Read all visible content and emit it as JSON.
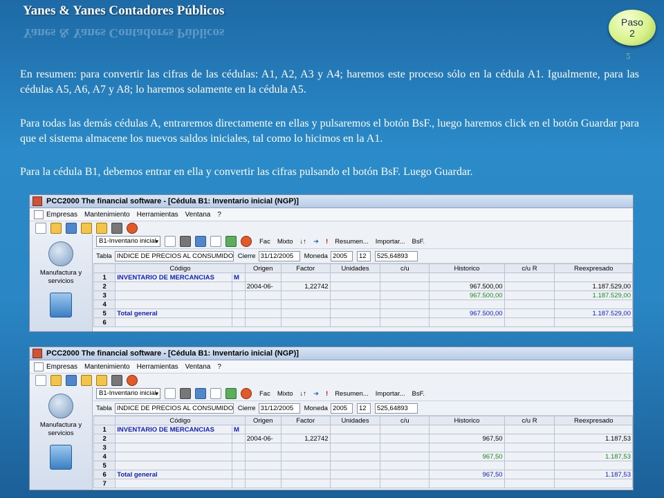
{
  "slide": {
    "title": "Yanes & Yanes Contadores Públicos",
    "step_line1": "Paso",
    "step_line2": "2",
    "step_reflect": "2",
    "para1": "En resumen: para convertir las cifras de las cédulas: A1, A2, A3 y A4; haremos este proceso sólo en la cédula A1. Igualmente, para las cédulas A5, A6, A7 y A8; lo haremos solamente en la cédula A5.",
    "para2": "Para todas las demás cédulas A, entraremos directamente en ellas y pulsaremos el botón BsF., luego haremos click en el botón Guardar para que el sistema almacene los nuevos saldos iniciales, tal como lo hicimos en la A1.",
    "para3": "Para la cédula B1, debemos entrar en ella y convertir las cifras pulsando el botón BsF. Luego Guardar."
  },
  "app": {
    "window_title": "PCC2000 The financial software - [Cédula B1: Inventario inicial (NGP)]",
    "menu": [
      "Empresas",
      "Mantenimiento",
      "Herramientas",
      "Ventana",
      "?"
    ],
    "sidebar_label": "Manufactura y servicios",
    "sheet_combo": "B1-Inventario inicial",
    "buttons": {
      "fac": "Fac",
      "mixto": "Mixto",
      "resumen": "Resumen...",
      "importar": "Importar...",
      "bsf": "BsF."
    },
    "labels": {
      "tabla": "Tabla",
      "cierre": "Cierre",
      "moneda": "Moneda"
    },
    "fields": {
      "tabla": "INDICE DE PRECIOS AL CONSUMIDOR",
      "cierre": "31/12/2005",
      "year": "2005",
      "month": "12",
      "factor_val": "525,64893"
    },
    "columns": [
      "Código",
      "Origen",
      "Factor",
      "Unidades",
      "c/u",
      "Historico",
      "c/u R",
      "Reexpresado"
    ]
  },
  "grid1": {
    "rows": [
      {
        "n": "1",
        "codigo": "INVENTARIO DE MERCANCIAS",
        "m": "M",
        "origen": "",
        "factor": "",
        "historico": "",
        "reexp": ""
      },
      {
        "n": "2",
        "codigo": "",
        "m": "",
        "origen": "2004-06-",
        "factor": "1,22742",
        "historico": "967.500,00",
        "reexp": "1.187.529,00"
      },
      {
        "n": "3",
        "codigo": "",
        "m": "",
        "origen": "",
        "factor": "",
        "historico": "967.500,00",
        "reexp": "1.187.529,00"
      },
      {
        "n": "4",
        "codigo": "",
        "m": "",
        "origen": "",
        "factor": "",
        "historico": "",
        "reexp": ""
      },
      {
        "n": "5",
        "codigo": "Total general",
        "m": "",
        "origen": "",
        "factor": "",
        "historico": "967.500,00",
        "reexp": "1.187.529,00"
      },
      {
        "n": "6",
        "codigo": "",
        "m": "",
        "origen": "",
        "factor": "",
        "historico": "",
        "reexp": ""
      }
    ]
  },
  "grid2": {
    "rows": [
      {
        "n": "1",
        "codigo": "INVENTARIO DE MERCANCIAS",
        "m": "M",
        "origen": "",
        "factor": "",
        "historico": "",
        "reexp": ""
      },
      {
        "n": "2",
        "codigo": "",
        "m": "",
        "origen": "2004-06-",
        "factor": "1,22742",
        "historico": "967,50",
        "reexp": "1.187,53"
      },
      {
        "n": "3",
        "codigo": "",
        "m": "",
        "origen": "",
        "factor": "",
        "historico": "",
        "reexp": ""
      },
      {
        "n": "4",
        "codigo": "",
        "m": "",
        "origen": "",
        "factor": "",
        "historico": "967,50",
        "reexp": "1.187,53"
      },
      {
        "n": "5",
        "codigo": "",
        "m": "",
        "origen": "",
        "factor": "",
        "historico": "",
        "reexp": ""
      },
      {
        "n": "6",
        "codigo": "Total general",
        "m": "",
        "origen": "",
        "factor": "",
        "historico": "967,50",
        "reexp": "1.187,53"
      },
      {
        "n": "7",
        "codigo": "",
        "m": "",
        "origen": "",
        "factor": "",
        "historico": "",
        "reexp": ""
      }
    ]
  },
  "colors": {
    "blue_text": "#1220c8",
    "green_text": "#1a8a1a",
    "background": "#2a86c4"
  }
}
